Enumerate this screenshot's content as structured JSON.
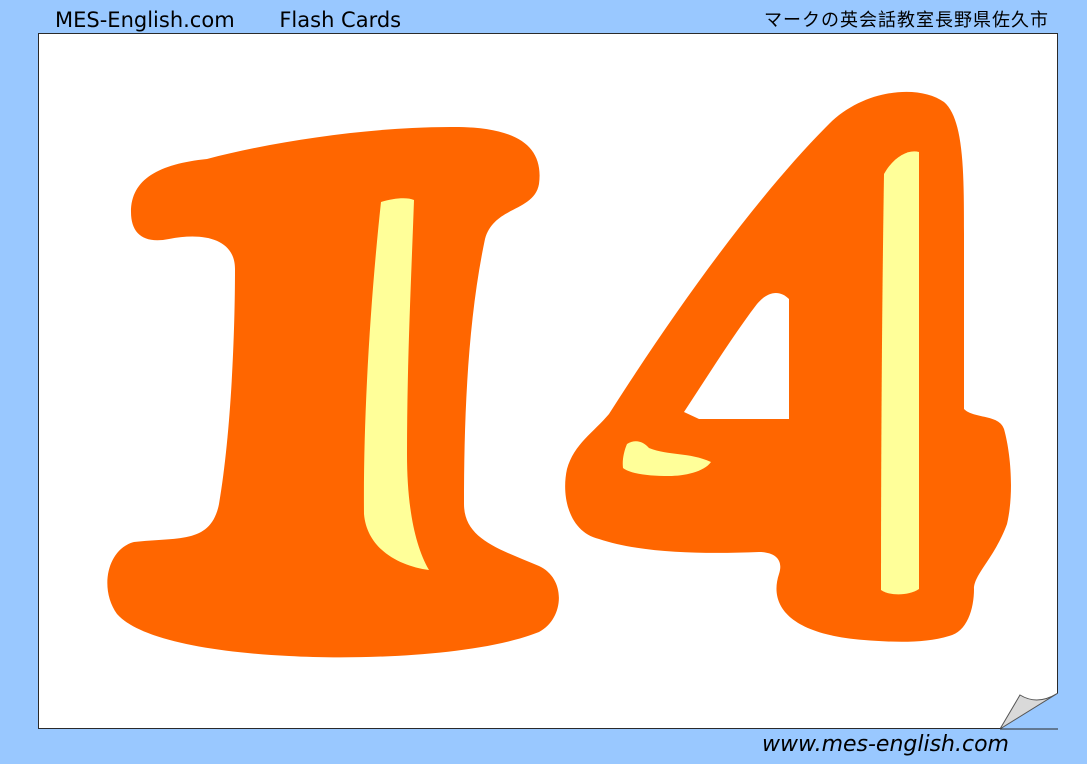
{
  "header": {
    "site_name": "MES-English.com",
    "section": "Flash Cards",
    "japanese_caption": "マークの英会話教室長野県佐久市"
  },
  "card": {
    "number_text": "14",
    "colors": {
      "number_fill": "#ff6600",
      "highlight_fill": "#ffff99",
      "card_background": "#ffffff",
      "page_background": "#99c8ff"
    }
  },
  "footer": {
    "url_text": "www.mes-english.com"
  },
  "icons": {
    "page_curl": "page-curl-icon"
  }
}
